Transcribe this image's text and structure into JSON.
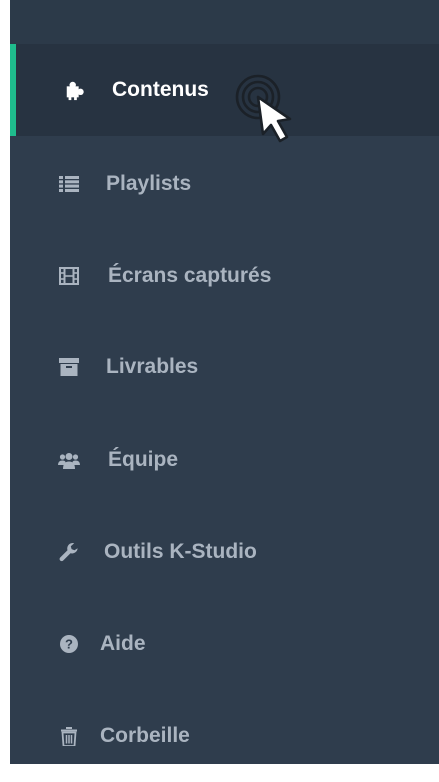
{
  "sidebar": {
    "accent_color": "#1fbc8d",
    "items": [
      {
        "label": "Contenus",
        "icon": "puzzle-icon",
        "active": true
      },
      {
        "label": "Playlists",
        "icon": "list-icon",
        "active": false
      },
      {
        "label": "Écrans capturés",
        "icon": "film-icon",
        "active": false
      },
      {
        "label": "Livrables",
        "icon": "archive-icon",
        "active": false
      },
      {
        "label": "Équipe",
        "icon": "users-icon",
        "active": false
      },
      {
        "label": "Outils K-Studio",
        "icon": "wrench-icon",
        "active": false
      },
      {
        "label": "Aide",
        "icon": "question-circle-icon",
        "active": false
      },
      {
        "label": "Corbeille",
        "icon": "trash-icon",
        "active": false
      }
    ]
  }
}
